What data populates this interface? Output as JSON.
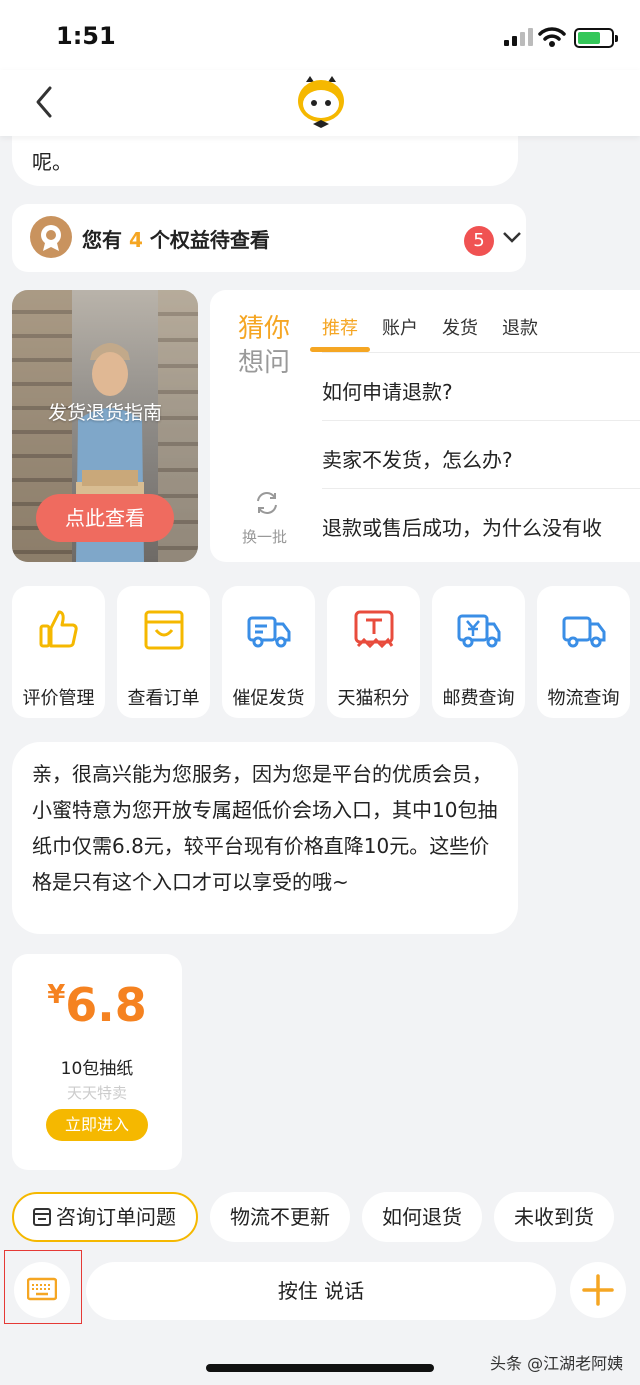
{
  "status": {
    "time": "1:51"
  },
  "chat": {
    "top_bubble_tail": "呢。",
    "rights": {
      "prefix": "您有",
      "count": "4",
      "suffix": "个权益待查看",
      "badge": "5"
    },
    "promo": {
      "title": "发货退货指南",
      "button": "点此查看"
    },
    "guess": {
      "title_line1": "猜你",
      "title_line2": "想问",
      "refresh_label": "换一批",
      "tabs": [
        {
          "label": "推荐",
          "active": true
        },
        {
          "label": "账户",
          "active": false
        },
        {
          "label": "发货",
          "active": false
        },
        {
          "label": "退款",
          "active": false
        }
      ],
      "questions": [
        "如何申请退款?",
        "卖家不发货，怎么办?",
        "退款或售后成功，为什么没有收"
      ]
    },
    "shortcuts": [
      {
        "label": "评价管理",
        "icon": "thumbs-up-icon"
      },
      {
        "label": "查看订单",
        "icon": "order-box-icon"
      },
      {
        "label": "催促发货",
        "icon": "truck-icon"
      },
      {
        "label": "天猫积分",
        "icon": "tmall-points-icon"
      },
      {
        "label": "邮费查询",
        "icon": "postage-truck-icon"
      },
      {
        "label": "物流查询",
        "icon": "logistics-truck-icon"
      }
    ],
    "message": "亲，很高兴能为您服务，因为您是平台的优质会员，小蜜特意为您开放专属超低价会场入口，其中10包抽纸巾仅需6.8元，较平台现有价格直降10元。这些价格是只有这个入口才可以享受的哦~",
    "product_card": {
      "currency": "¥",
      "price": "6.8",
      "name": "10包抽纸",
      "subtitle": "天天特卖",
      "button": "立即进入"
    }
  },
  "quick_chips": [
    "咨询订单问题",
    "物流不更新",
    "如何退货",
    "未收到货"
  ],
  "input_bar": {
    "hold_to_talk": "按住 说话"
  },
  "watermark": "头条 @江湖老阿姨",
  "colors": {
    "accent": "#f5a623",
    "button_red": "#ef6b5f",
    "badge_red": "#f05252",
    "price_orange": "#f58220"
  }
}
